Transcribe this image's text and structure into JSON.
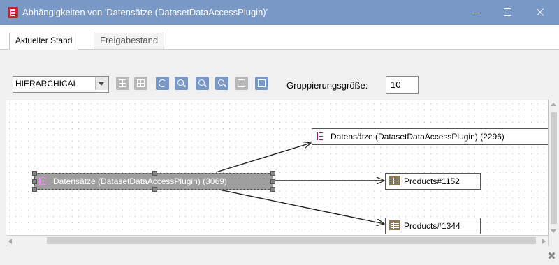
{
  "window": {
    "title": "Abhängigkeiten von 'Datensätze (DatasetDataAccessPlugin)'"
  },
  "tabs": [
    {
      "label": "Aktueller Stand",
      "active": true
    },
    {
      "label": "Freigabestand",
      "active": false
    }
  ],
  "toolbar": {
    "layout_select": {
      "value": "HIERARCHICAL"
    },
    "buttons": [
      {
        "icon": "grid-layout-icon"
      },
      {
        "icon": "grid-layout-alt-icon"
      },
      {
        "icon": "refresh-icon"
      },
      {
        "icon": "zoom-in-icon"
      },
      {
        "icon": "zoom-out-icon"
      },
      {
        "icon": "zoom-fit-icon"
      },
      {
        "icon": "delete-icon"
      },
      {
        "icon": "export-icon"
      }
    ],
    "grouping_label": "Gruppierungsgröße:",
    "grouping_value": "10"
  },
  "graph": {
    "nodes": [
      {
        "id": "ds3069",
        "label": "Datensätze (DatasetDataAccessPlugin) (3069)",
        "icon": "dataset-icon",
        "selected": true
      },
      {
        "id": "ds2296",
        "label": "Datensätze (DatasetDataAccessPlugin) (2296)",
        "icon": "dataset-icon",
        "selected": false
      },
      {
        "id": "p1152",
        "label": "Products#1152",
        "icon": "table-icon",
        "selected": false
      },
      {
        "id": "p1344",
        "label": "Products#1344",
        "icon": "table-icon",
        "selected": false
      }
    ],
    "edges": [
      {
        "from": "ds3069",
        "to": "ds2296"
      },
      {
        "from": "ds3069",
        "to": "p1152"
      },
      {
        "from": "ds3069",
        "to": "p1344"
      }
    ]
  },
  "colors": {
    "titlebar": "#7a98c6",
    "selected_node": "#9f9f9f",
    "toolbar_button": "#7a98c6"
  }
}
